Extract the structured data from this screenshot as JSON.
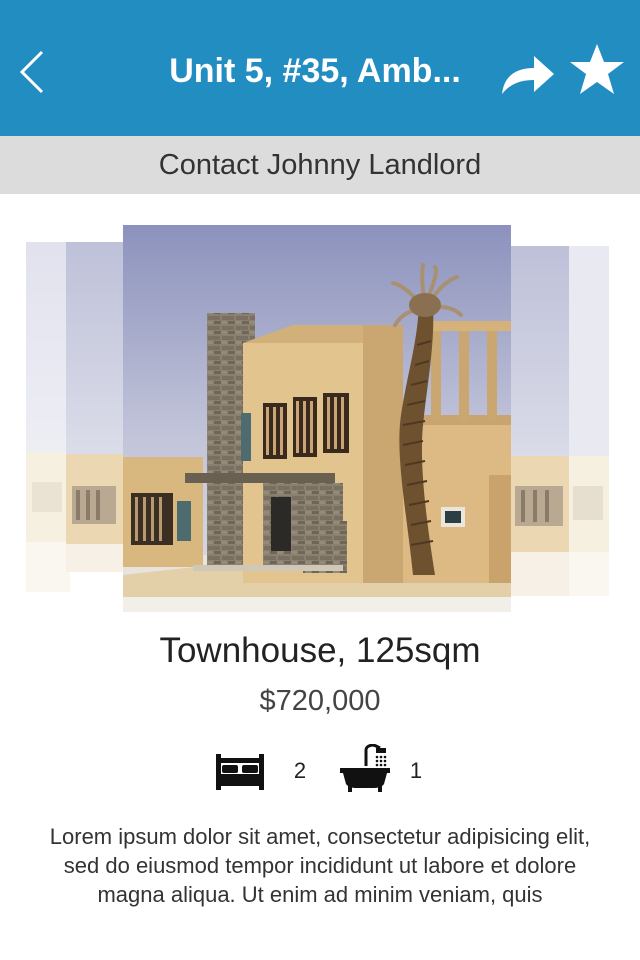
{
  "header": {
    "title": "Unit 5, #35, Amb...",
    "back_icon": "chevron-left-icon",
    "share_icon": "share-arrow-icon",
    "favorite_icon": "star-icon",
    "background_color": "#228dc1"
  },
  "contact": {
    "label": "Contact Johnny Landlord",
    "background_color": "#dcdcdc"
  },
  "property": {
    "title": "Townhouse, 125sqm",
    "price": "$720,000",
    "bedrooms": "2",
    "bathrooms": "1",
    "bed_icon": "bed-icon",
    "bath_icon": "bathtub-icon",
    "description": "Lorem ipsum dolor sit amet, consectetur adipisicing elit, sed do eiusmod tempor incididunt ut labore et dolore magna aliqua. Ut enim ad minim veniam, quis"
  }
}
